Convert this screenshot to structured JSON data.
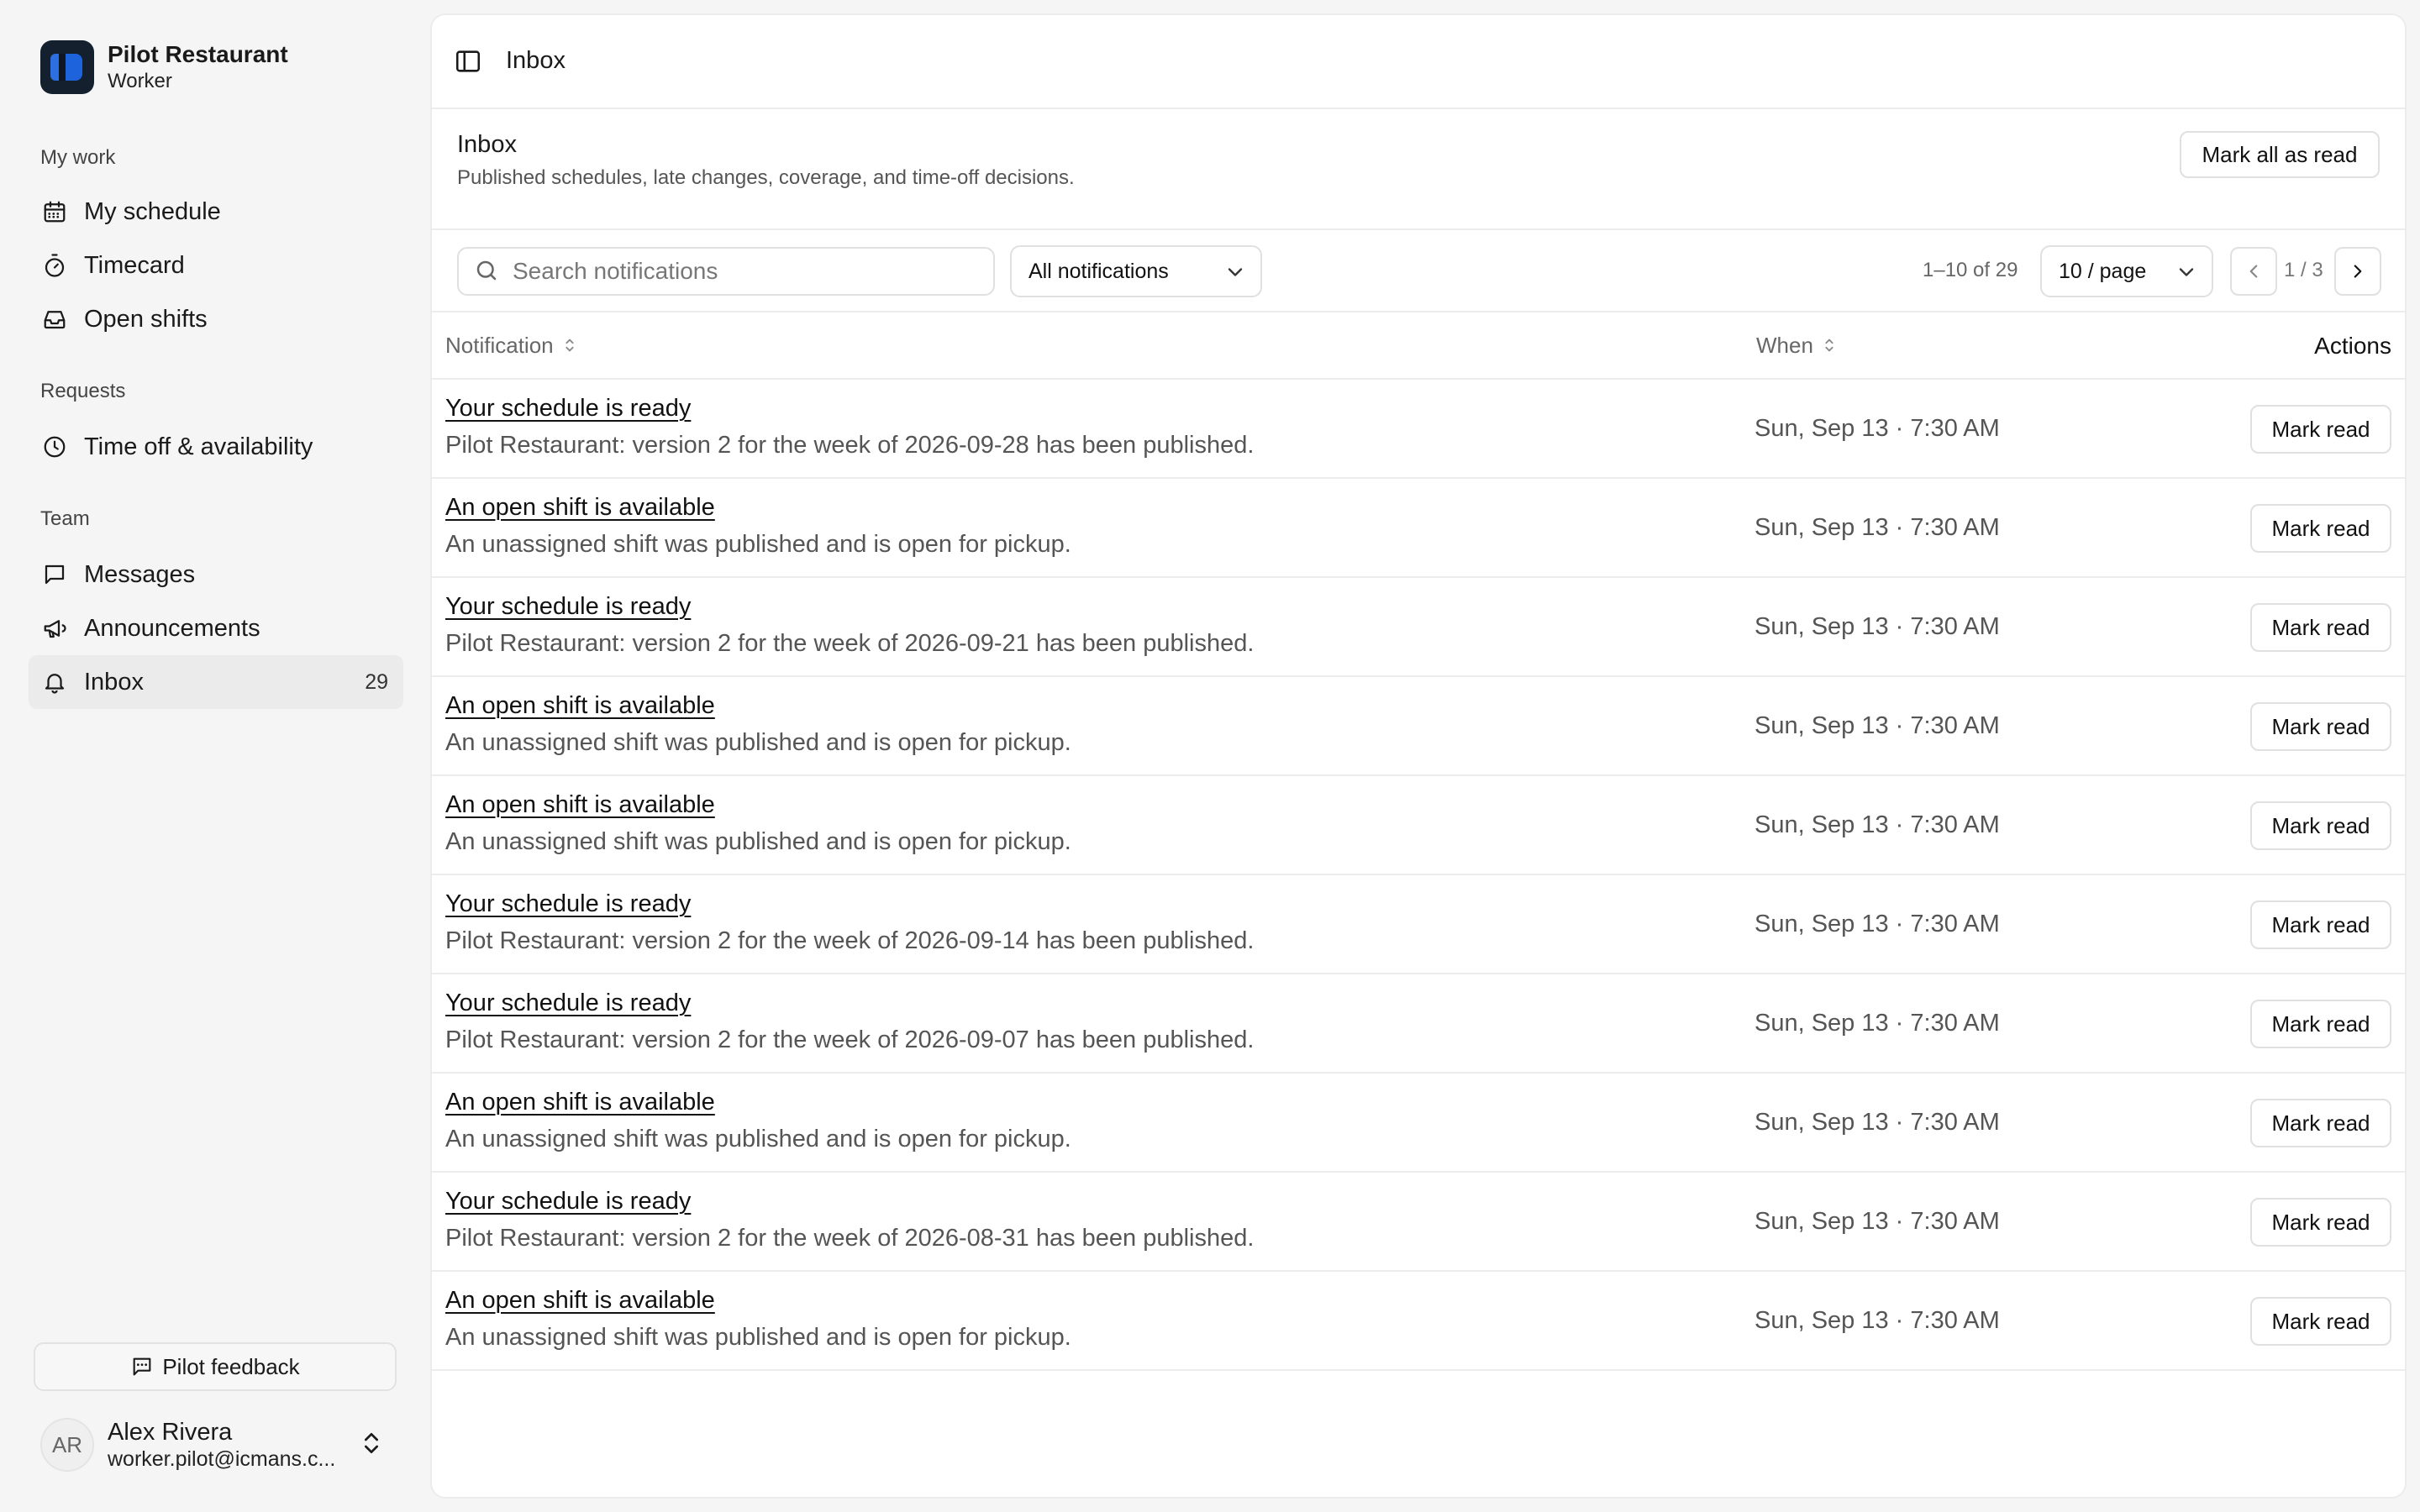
{
  "app": {
    "name": "Pilot Restaurant",
    "role": "Worker"
  },
  "sidebar": {
    "sections": [
      {
        "label": "My work",
        "items": [
          {
            "label": "My schedule",
            "icon": "calendar-icon"
          },
          {
            "label": "Timecard",
            "icon": "stopwatch-icon"
          },
          {
            "label": "Open shifts",
            "icon": "inbox-tray-icon"
          }
        ]
      },
      {
        "label": "Requests",
        "items": [
          {
            "label": "Time off & availability",
            "icon": "clock-icon"
          }
        ]
      },
      {
        "label": "Team",
        "items": [
          {
            "label": "Messages",
            "icon": "message-square-icon"
          },
          {
            "label": "Announcements",
            "icon": "megaphone-icon"
          },
          {
            "label": "Inbox",
            "icon": "bell-icon",
            "count": "29",
            "active": true
          }
        ]
      }
    ],
    "feedback_label": "Pilot feedback",
    "user": {
      "initials": "AR",
      "name": "Alex Rivera",
      "email": "worker.pilot@icmans.c..."
    }
  },
  "topbar": {
    "title": "Inbox"
  },
  "header": {
    "title": "Inbox",
    "subtitle": "Published schedules, late changes, coverage, and time-off decisions.",
    "mark_all_label": "Mark all as read"
  },
  "toolbar": {
    "search_placeholder": "Search notifications",
    "filter_value": "All notifications",
    "range_label": "1–10 of 29",
    "page_size_value": "10 / page",
    "page_indicator": "1 / 3"
  },
  "table": {
    "columns": {
      "notification": "Notification",
      "when": "When",
      "actions": "Actions"
    },
    "action_label": "Mark read",
    "rows": [
      {
        "title": "Your schedule is ready",
        "desc": "Pilot Restaurant: version 2 for the week of 2026-09-28 has been published.",
        "when": "Sun, Sep 13 · 7:30 AM"
      },
      {
        "title": "An open shift is available",
        "desc": "An unassigned shift was published and is open for pickup.",
        "when": "Sun, Sep 13 · 7:30 AM"
      },
      {
        "title": "Your schedule is ready",
        "desc": "Pilot Restaurant: version 2 for the week of 2026-09-21 has been published.",
        "when": "Sun, Sep 13 · 7:30 AM"
      },
      {
        "title": "An open shift is available",
        "desc": "An unassigned shift was published and is open for pickup.",
        "when": "Sun, Sep 13 · 7:30 AM"
      },
      {
        "title": "An open shift is available",
        "desc": "An unassigned shift was published and is open for pickup.",
        "when": "Sun, Sep 13 · 7:30 AM"
      },
      {
        "title": "Your schedule is ready",
        "desc": "Pilot Restaurant: version 2 for the week of 2026-09-14 has been published.",
        "when": "Sun, Sep 13 · 7:30 AM"
      },
      {
        "title": "Your schedule is ready",
        "desc": "Pilot Restaurant: version 2 for the week of 2026-09-07 has been published.",
        "when": "Sun, Sep 13 · 7:30 AM"
      },
      {
        "title": "An open shift is available",
        "desc": "An unassigned shift was published and is open for pickup.",
        "when": "Sun, Sep 13 · 7:30 AM"
      },
      {
        "title": "Your schedule is ready",
        "desc": "Pilot Restaurant: version 2 for the week of 2026-08-31 has been published.",
        "when": "Sun, Sep 13 · 7:30 AM"
      },
      {
        "title": "An open shift is available",
        "desc": "An unassigned shift was published and is open for pickup.",
        "when": "Sun, Sep 13 · 7:30 AM"
      }
    ]
  }
}
